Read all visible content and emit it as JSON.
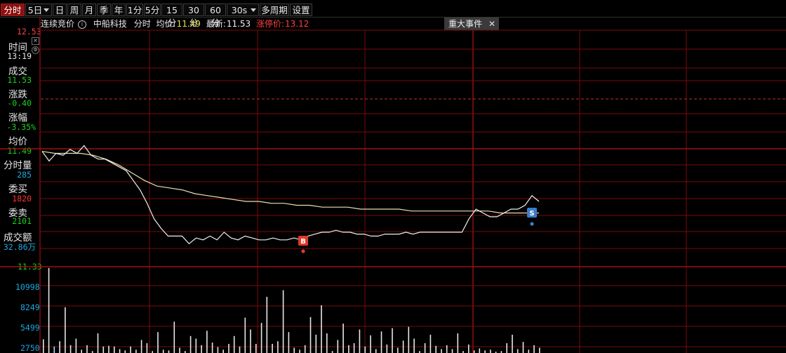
{
  "toolbar": {
    "items": [
      "分时",
      "5日",
      "日",
      "周",
      "月",
      "季",
      "年",
      "1分",
      "5分",
      "15分",
      "30分",
      "60分",
      "30s",
      "多周期",
      "设置"
    ],
    "active": "分时"
  },
  "info": {
    "mode": "连续竞价",
    "info_icon": "info-circle-icon",
    "stock_name": "中船科技",
    "view": "分时",
    "avg_label": "均价:",
    "avg_value": "11.49",
    "latest_label": "最新:",
    "latest_value": "11.53",
    "limit_label": "涨停价:",
    "limit_value": "13.12"
  },
  "event_button": {
    "label": "重大事件",
    "close": "✕"
  },
  "sidebar": {
    "close_icon": "close-icon",
    "settings_icon": "gear-icon",
    "fields": [
      {
        "label": "时间",
        "value": "13:19",
        "color": "#e6e6e6"
      },
      {
        "label": "成交",
        "value": "11.53",
        "color": "#19d219"
      },
      {
        "label": "涨跌",
        "value": "-0.40",
        "color": "#19d219"
      },
      {
        "label": "涨幅",
        "value": "-3.35%",
        "color": "#19d219"
      },
      {
        "label": "均价",
        "value": "11.49",
        "color": "#19d219"
      },
      {
        "label": "分时量",
        "value": "285",
        "color": "#1aa9e0"
      },
      {
        "label": "委买",
        "value": "1820",
        "color": "#ff3030"
      },
      {
        "label": "委卖",
        "value": "2101",
        "color": "#19d219"
      },
      {
        "label": "成交额",
        "value": "32.86万",
        "color": "#1aa9e0"
      }
    ]
  },
  "price_axis": {
    "top": "12.53",
    "bottom": "11.33"
  },
  "volume_axis": [
    "10998",
    "8249",
    "5499",
    "2750"
  ],
  "markers": [
    {
      "label": "B",
      "color": "#e03a2a"
    },
    {
      "label": "S",
      "color": "#3a7ecc"
    }
  ],
  "colors": {
    "grid": "#7a0a0a",
    "price_line": "#f0f0f0",
    "avg_line": "#e8e0b0",
    "volume_bar": "#e6e6e6",
    "volume_bar_accent": "#9fd8ff",
    "prev_close_dash": "#c03030"
  },
  "chart_data": {
    "type": "line",
    "title": "",
    "xlabel": "",
    "ylabel": "",
    "ylim": [
      11.33,
      12.53
    ],
    "series": [
      {
        "values": [
          11.9,
          11.85,
          11.89,
          11.88,
          11.91,
          11.89,
          11.93,
          11.88,
          11.86,
          11.86,
          11.84,
          11.82,
          11.8,
          11.75,
          11.7,
          11.63,
          11.55,
          11.5,
          11.46,
          11.46,
          11.46,
          11.42,
          11.45,
          11.44,
          11.46,
          11.44,
          11.48,
          11.45,
          11.44,
          11.46,
          11.45,
          11.44,
          11.44,
          11.45,
          11.44,
          11.44,
          11.45,
          11.44,
          11.46,
          11.47,
          11.48,
          11.48,
          11.49,
          11.48,
          11.48,
          11.47,
          11.47,
          11.46,
          11.46,
          11.47,
          11.47,
          11.47,
          11.48,
          11.47,
          11.48,
          11.48,
          11.48,
          11.48,
          11.48,
          11.48,
          11.48,
          11.55,
          11.6,
          11.58,
          11.56,
          11.56,
          11.58,
          11.6,
          11.6,
          11.62,
          11.67,
          11.64
        ]
      },
      {
        "values": [
          11.9,
          11.89,
          11.89,
          11.89,
          11.88,
          11.86,
          11.83,
          11.79,
          11.75,
          11.72,
          11.71,
          11.7,
          11.68,
          11.67,
          11.66,
          11.65,
          11.64,
          11.64,
          11.63,
          11.63,
          11.62,
          11.62,
          11.61,
          11.61,
          11.61,
          11.6,
          11.6,
          11.6,
          11.6,
          11.59,
          11.59,
          11.59,
          11.59,
          11.59,
          11.59,
          11.59,
          11.58,
          11.58,
          11.58,
          11.58
        ]
      }
    ],
    "volume": {
      "ylim": [
        0,
        13200
      ],
      "values": [
        2100,
        13000,
        1000,
        1800,
        7000,
        1200,
        2200,
        500,
        1200,
        300,
        3000,
        1000,
        1100,
        1000,
        600,
        400,
        1000,
        500,
        2000,
        1500,
        300,
        3200,
        500,
        400,
        4800,
        800,
        300,
        2600,
        2200,
        1200,
        3400,
        1600,
        900,
        500,
        1400,
        2600,
        1000,
        5400,
        3600,
        1400,
        4600,
        8600,
        1400,
        1800,
        9600,
        3200,
        800,
        500,
        1200,
        5500,
        2800,
        7300,
        3000,
        300,
        2000,
        4500,
        1200,
        1500,
        3600,
        1000,
        2700,
        600,
        3300,
        1300,
        3800,
        800,
        1900,
        4000,
        2200,
        300,
        1500,
        2800,
        1100,
        600,
        1200,
        600,
        3000,
        300,
        1300,
        400,
        700,
        400,
        500,
        200,
        300,
        1500,
        2800,
        600,
        1700,
        500,
        1200,
        800
      ],
      "accent_index": 2
    }
  }
}
